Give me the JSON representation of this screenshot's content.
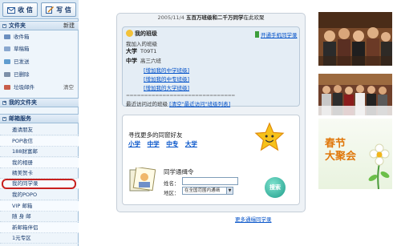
{
  "sidebar": {
    "buttons": {
      "receive": "收 信",
      "write": "写 信"
    },
    "folders_section": {
      "title": "文件夹",
      "action": "新建"
    },
    "folders": [
      {
        "label": "收件箱"
      },
      {
        "label": "草稿箱"
      },
      {
        "label": "已发送"
      },
      {
        "label": "已删除"
      },
      {
        "label": "垃圾邮件",
        "action": "清空"
      }
    ],
    "my_folders_title": "我的文件夹",
    "services_title": "邮箱服务",
    "services": [
      "邀请朋友",
      "POP收信",
      "188财富邮",
      "我的相册",
      "精美贺卡",
      "我的同学录",
      "我的POPO",
      "VIP 邮箱",
      "随 身 邮",
      "新邮箱伴侣",
      "1元专区"
    ]
  },
  "main": {
    "date": "2005/11/4",
    "welcome_bold": "五百万班级和二千万同学",
    "welcome_tail": "在此欢聚",
    "class_title": "我的班级",
    "mobile_link": "开通手机同学录",
    "joined_label": "我加入的班级",
    "university_label": "大学",
    "university_value": "T09T1",
    "middle_label": "中学",
    "middle_value": "高三六班",
    "add_links": [
      "[增加我的中学班级]",
      "[增加我的中专班级]",
      "[增加我的大学班级]"
    ],
    "separator": "==============================",
    "recent_label": "最近访问过的班级",
    "recent_link": "[清空\"最近访问\"班级列表]",
    "find_title": "寻找更多的同窗好友",
    "schools": [
      "小学",
      "中学",
      "中专",
      "大学"
    ],
    "addr_title": "同学通缉令",
    "name_label": "姓名：",
    "area_label": "地区：",
    "area_value": "在全国范围内通缉",
    "search_button": "搜索",
    "more_link": "更多通缉同学录"
  },
  "banner": {
    "line1": "春节",
    "line2": "大聚会"
  },
  "colors": {
    "link": "#0050c8",
    "highlight": "#c8201e",
    "banner_text": "#e0780c"
  }
}
